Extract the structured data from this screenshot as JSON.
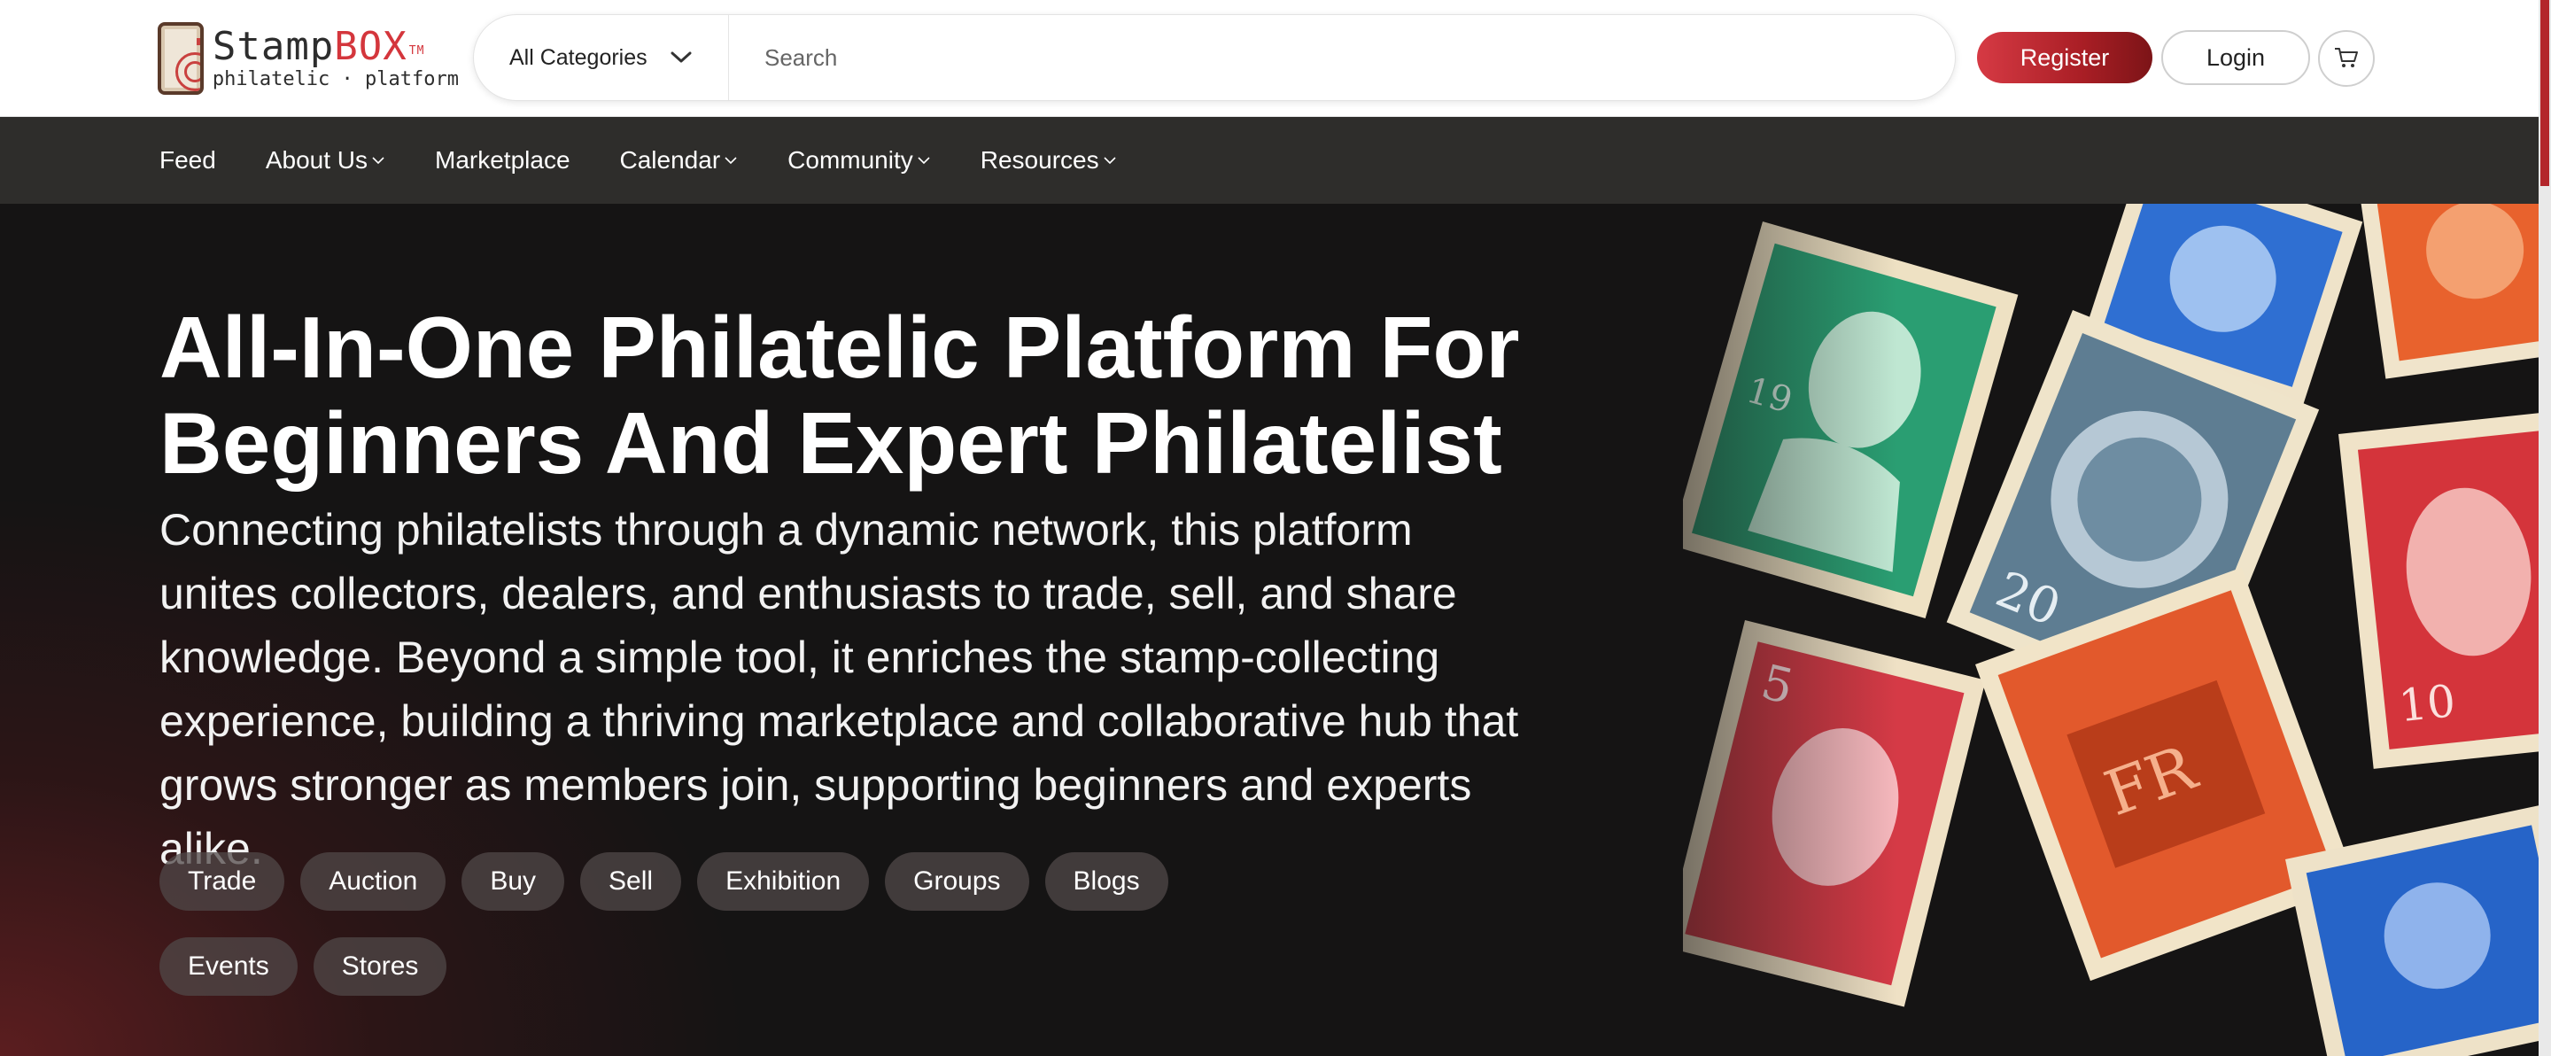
{
  "brand": {
    "name_part1": "Stamp",
    "name_part2": "BOX",
    "trademark": "TM",
    "tagline": "philatelic · platform",
    "accent_color": "#d4363c"
  },
  "search": {
    "category_selected": "All Categories",
    "placeholder": "Search",
    "value": ""
  },
  "actions": {
    "register_label": "Register",
    "login_label": "Login",
    "cart_icon": "cart-icon"
  },
  "nav": {
    "items": [
      {
        "label": "Feed",
        "has_dropdown": false
      },
      {
        "label": "About Us",
        "has_dropdown": true
      },
      {
        "label": "Marketplace",
        "has_dropdown": false
      },
      {
        "label": "Calendar",
        "has_dropdown": true
      },
      {
        "label": "Community",
        "has_dropdown": true
      },
      {
        "label": "Resources",
        "has_dropdown": true
      }
    ],
    "background": "#2e2d2b"
  },
  "hero": {
    "title_line1": "All-In-One Philatelic Platform For",
    "title_line2": "Beginners And Expert Philatelist",
    "description": "Connecting philatelists through a dynamic network, this platform unites collectors, dealers, and enthusiasts to trade, sell, and share knowledge. Beyond a simple tool, it enriches the stamp-collecting experience, building a thriving marketplace and collaborative hub that grows stronger as members join, supporting beginners and experts alike.",
    "chips": [
      "Trade",
      "Auction",
      "Buy",
      "Sell",
      "Exhibition",
      "Groups",
      "Blogs",
      "Events",
      "Stores"
    ]
  }
}
